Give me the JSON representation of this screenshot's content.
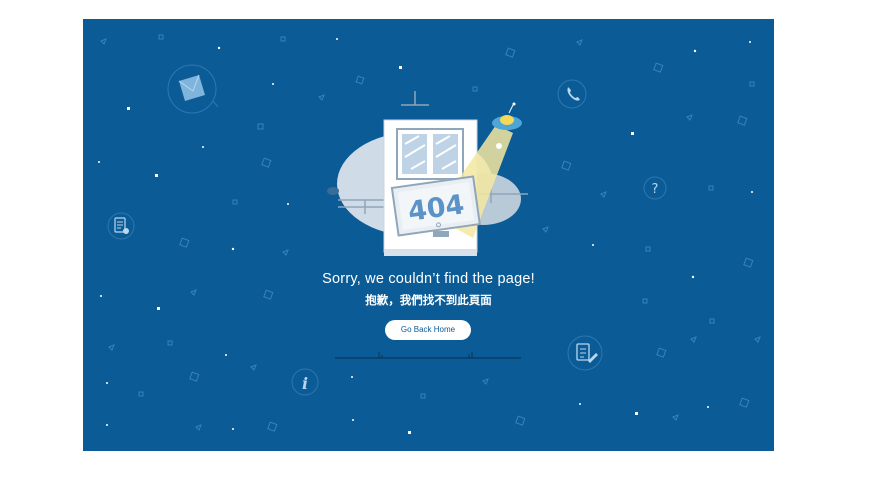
{
  "error_page": {
    "code": "404",
    "heading": "Sorry, we couldn’t find the page!",
    "subheading": "抱歉，我們找不到此頁面",
    "home_button_label": "Go Back Home"
  },
  "colors": {
    "background": "#0b5b96",
    "white": "#ffffff"
  },
  "icons": [
    "envelope-icon",
    "phone-icon",
    "question-icon",
    "document-icon",
    "info-icon",
    "pencil-note-icon",
    "ufo-icon"
  ]
}
